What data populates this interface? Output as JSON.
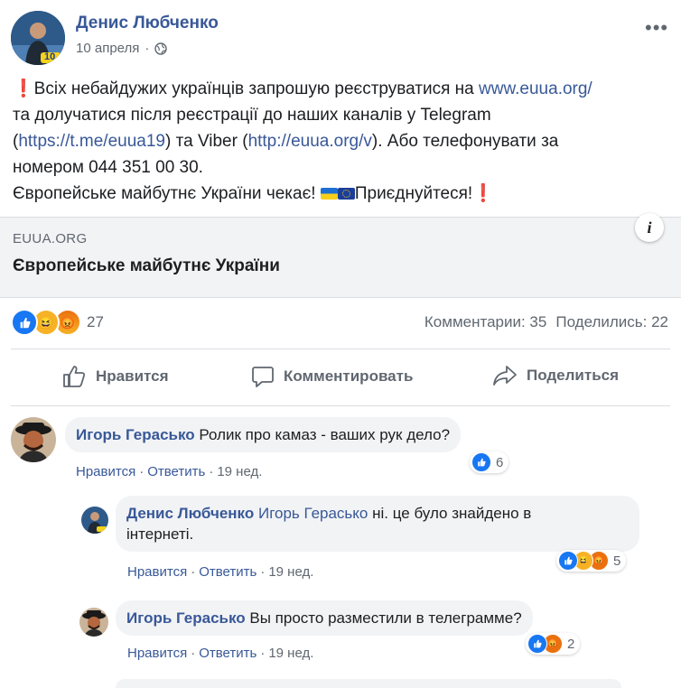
{
  "post": {
    "author": "Денис Любченко",
    "date": "10 апреля",
    "date_sep": "·",
    "avatar_badge": "10",
    "body": {
      "l1_text": "Всіх небайдужих українців запрошую реєструватися на ",
      "l1_link": "www.euua.org/",
      "l2_text": "та долучатися після реєстрації до наших каналів у Telegram",
      "l3_open": "(",
      "l3_link1": "https://t.me/euua19",
      "l3_mid": ") та Viber (",
      "l3_link2": "http://euua.org/v",
      "l3_end": "). Або телефонувати за",
      "l4_text": "номером 044 351 00 30.",
      "l5_text": "Європейське майбутнє України чекає! ",
      "l5_end": "Приєднуйтеся!",
      "excl": "❗"
    }
  },
  "link_preview": {
    "domain": "EUUA.ORG",
    "title": "Європейське майбутнє України",
    "info_icon": "i"
  },
  "reactions": {
    "count": "27",
    "comments": "Комментарии: 35",
    "shares": "Поделились: 22"
  },
  "actions": {
    "like": "Нравится",
    "comment": "Комментировать",
    "share": "Поделиться"
  },
  "comments": [
    {
      "author": "Игорь Герасько",
      "text": "Ролик про камаз - ваших рук дело?",
      "like": "Нравится",
      "reply": "Ответить",
      "time": "19 нед.",
      "reactions": "6"
    },
    {
      "author": "Денис Любченко",
      "mention": "Игорь Герасько",
      "text_1": " ні. це було знайдено в",
      "text_2": "інтернеті.",
      "like": "Нравится",
      "reply": "Ответить",
      "time": "19 нед.",
      "reactions": "5"
    },
    {
      "author": "Игорь Герасько",
      "text": "Вы просто разместили в телеграмме?",
      "like": "Нравится",
      "reply": "Ответить",
      "time": "19 нед.",
      "reactions": "2"
    }
  ],
  "colors": {
    "link": "#385898",
    "like_blue": "#1877f2",
    "muted": "#606770",
    "card_bg": "#f2f3f5"
  }
}
